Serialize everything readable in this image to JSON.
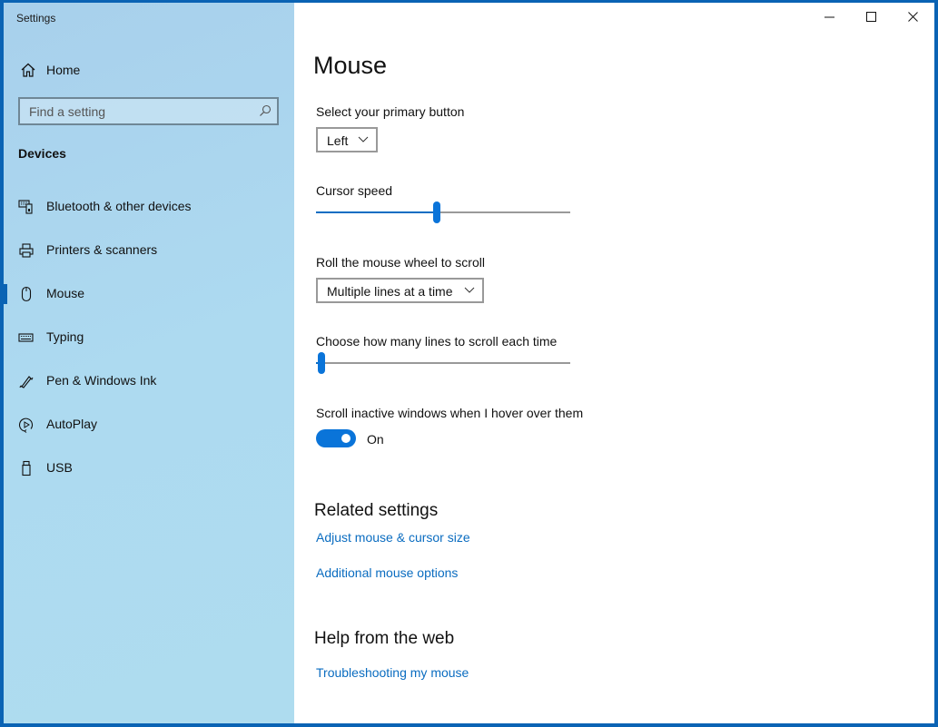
{
  "window": {
    "app_title": "Settings",
    "controls": {
      "minimize": "minimize-icon",
      "maximize": "maximize-icon",
      "close": "close-icon"
    }
  },
  "sidebar": {
    "home_label": "Home",
    "search_placeholder": "Find a setting",
    "section_title": "Devices",
    "items": [
      {
        "label": "Bluetooth & other devices",
        "icon": "bluetooth-devices-icon",
        "selected": false
      },
      {
        "label": "Printers & scanners",
        "icon": "printer-icon",
        "selected": false
      },
      {
        "label": "Mouse",
        "icon": "mouse-icon",
        "selected": true
      },
      {
        "label": "Typing",
        "icon": "keyboard-icon",
        "selected": false
      },
      {
        "label": "Pen & Windows Ink",
        "icon": "pen-icon",
        "selected": false
      },
      {
        "label": "AutoPlay",
        "icon": "autoplay-icon",
        "selected": false
      },
      {
        "label": "USB",
        "icon": "usb-icon",
        "selected": false
      }
    ]
  },
  "main": {
    "title": "Mouse",
    "primary_button": {
      "label": "Select your primary button",
      "value": "Left"
    },
    "cursor_speed": {
      "label": "Cursor speed",
      "value": 10,
      "min": 1,
      "max": 20
    },
    "wheel_scroll": {
      "label": "Roll the mouse wheel to scroll",
      "value": "Multiple lines at a time"
    },
    "lines_to_scroll": {
      "label": "Choose how many lines to scroll each time",
      "value": 3,
      "min": 1,
      "max": 100
    },
    "scroll_inactive": {
      "label": "Scroll inactive windows when I hover over them",
      "state": "On",
      "on": true
    },
    "related_settings": {
      "heading": "Related settings",
      "links": [
        "Adjust mouse & cursor size",
        "Additional mouse options"
      ]
    },
    "help": {
      "heading": "Help from the web",
      "links": [
        "Troubleshooting my mouse"
      ]
    }
  },
  "colors": {
    "accent": "#0a74d9",
    "link": "#0a6cc0",
    "sidebar_bg": "#addaf0",
    "border": "#0a63b4"
  }
}
